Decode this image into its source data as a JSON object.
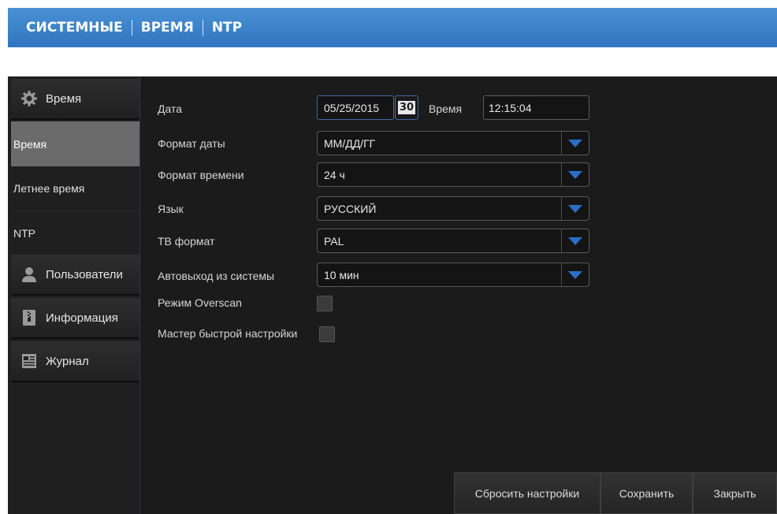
{
  "breadcrumb": [
    "СИСТЕМНЫЕ",
    "ВРЕМЯ",
    "NTP"
  ],
  "sidebar": {
    "categories": [
      {
        "label": "Время",
        "icon": "gear-icon"
      },
      {
        "label": "Пользователи",
        "icon": "user-icon"
      },
      {
        "label": "Информация",
        "icon": "info-icon"
      },
      {
        "label": "Журнал",
        "icon": "log-icon"
      }
    ],
    "items": [
      {
        "label": "Время",
        "active": true
      },
      {
        "label": "Летнее время",
        "active": false
      },
      {
        "label": "NTP",
        "active": false
      }
    ]
  },
  "form": {
    "date_label": "Дата",
    "date_value": "05/25/2015",
    "calendar_day": "30",
    "time_label": "Время",
    "time_value": "12:15:04",
    "date_format_label": "Формат даты",
    "date_format_value": "ММ/ДД/ГГ",
    "time_format_label": "Формат времени",
    "time_format_value": "24 ч",
    "language_label": "Язык",
    "language_value": "РУССКИЙ",
    "tv_format_label": "ТВ формат",
    "tv_format_value": "PAL",
    "autologout_label": "Автовыход из системы",
    "autologout_value": "10 мин",
    "overscan_label": "Режим Overscan",
    "wizard_label": "Мастер быстрой настройки"
  },
  "buttons": {
    "reset": "Сбросить настройки",
    "save": "Сохранить",
    "close": "Закрыть"
  },
  "colors": {
    "accent": "#2f76c0",
    "dropdown_arrow": "#2a6fc4"
  }
}
